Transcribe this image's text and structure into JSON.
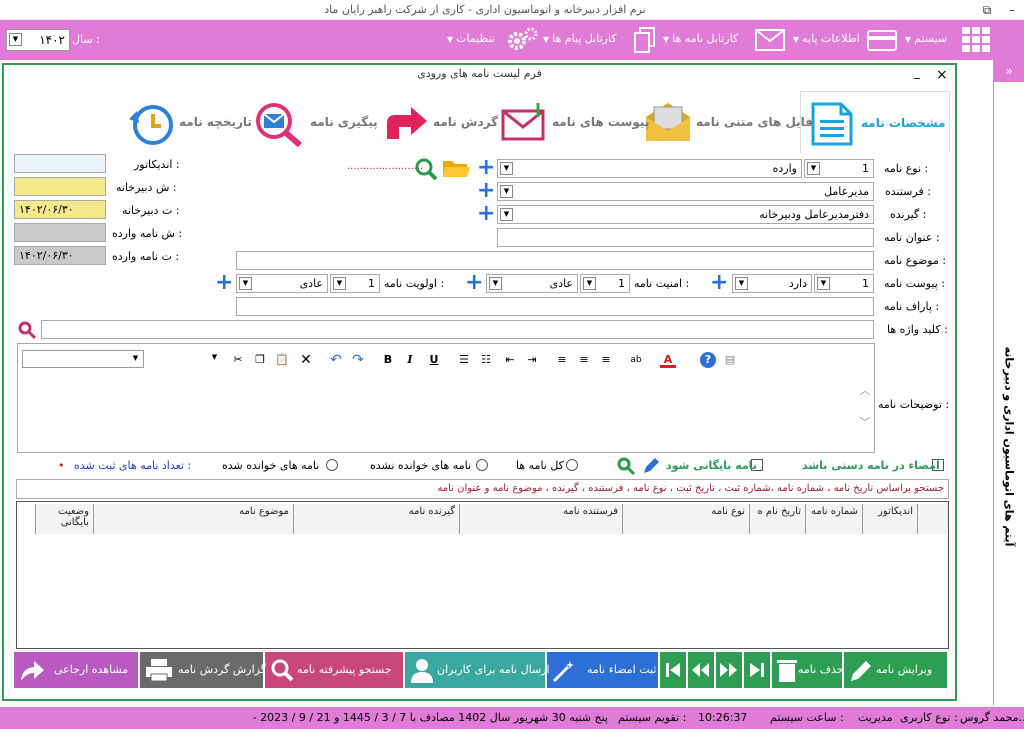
{
  "window": {
    "title": "نرم افزار دبیرخانه و اتوماسیون اداری - کاری از شرکت راهبر رایان ماد",
    "restore_icon": "⧉",
    "min_icon": "–"
  },
  "menubar": {
    "system": "سیستم",
    "base_info": "اطلاعات پایه",
    "letter_cardex": "کارتابل نامه ها",
    "message_cardex": "کارتابل پیام ها",
    "settings": "تنظیمات",
    "year_label": "سال :",
    "year_value": "۱۴۰۲"
  },
  "sidebar": {
    "toggle": "»",
    "title": "آیتم های اتوماسیون اداری و دبیرخانه"
  },
  "form": {
    "title": "فرم لیست نامه های ورودی",
    "close": "×",
    "min": "_",
    "tabs": {
      "specs": "مشخصات نامه",
      "text_files": "فایل های متنی نامه",
      "attachments": "پیوست های نامه",
      "circulation": "گردش نامه",
      "followup": "پیگیری نامه",
      "history": "تاریخچه نامه"
    },
    "fields": {
      "letter_type_label": "نوع نامه :",
      "letter_type_code": "1",
      "letter_type_value": "وارده",
      "sender_label": "فرستنده :",
      "sender_value": "مدیرعامل",
      "receiver_label": "گیرنده :",
      "receiver_value": "دفترمدیرعامل ودبیرخانه",
      "title_label": "عنوان نامه :",
      "subject_label": "موضوع نامه :",
      "attachment_label": "پیوست نامه :",
      "attachment_code": "1",
      "attachment_value": "دارد",
      "security_label": "امنیت نامه :",
      "security_code": "1",
      "security_value": "عادی",
      "priority_label": "اولویت نامه :",
      "priority_code": "1",
      "priority_value": "عادی",
      "paraf_label": "پاراف نامه :",
      "keywords_label": "کلید واژه ها :",
      "desc_label": "توضیحات نامه :",
      "indicator_label": "اندیکاتور :",
      "secretariat_no_label": "ش دبیرخانه :",
      "secretariat_date_label": "ت دبیرخانه :",
      "secretariat_date_value": "۱۴۰۲/۰۶/۳۰",
      "incoming_no_label": "ش نامه وارده :",
      "incoming_date_label": "ت نامه وارده :",
      "incoming_date_value": "۱۴۰۲/۰۶/۳۰",
      "dots": "........................"
    },
    "options": {
      "manual_sign": "امضاء در نامه دستی باشد",
      "archive": "نامه بایگانی شود",
      "all_letters": "کل نامه ها",
      "unread_letters": "نامه های خوانده نشده",
      "read_letters": "نامه های خوانده شده",
      "count_label": "تعداد نامه های ثبت شده :",
      "count_value": "•"
    },
    "search_hint": "جستجو براساس تاریخ نامه ، شماره نامه ،شماره ثبت ، تاریخ ثبت ، نوع نامه ، فرستنده ، گیرنده ، موضوع نامه و عنوان نامه",
    "grid_headers": [
      "اندیکاتور",
      "شماره نامه",
      "تاریخ نام ه",
      "نوع نامه",
      "فرستنده نامه",
      "گیرنده نامه",
      "موضوع نامه",
      "وضعیت بایگانی"
    ],
    "buttons": {
      "edit": "ویرایش نامه",
      "delete": "حذف نامه",
      "sign": "ثبت امضاء نامه",
      "send_users": "ارسال نامه برای کاربران",
      "adv_search": "جستجو پیشرفته نامه",
      "circulation_report": "گزارش گردش نامه",
      "view_referral": "مشاهده ارجاعی"
    }
  },
  "status": {
    "user": "محمد گروس...",
    "user_type_label": "نوع کاربری :",
    "user_type": "مدیریت",
    "time_label": "ساعت سیستم :",
    "time": "10:26:37",
    "calendar_label": "تقویم سیستم :",
    "calendar": "پنج شنبه   30   شهریور   سال   1402   مصادف با   7 / 3 / 1445   و   21 / 9 / 2023 -"
  },
  "colors": {
    "accent": "#e07bd8",
    "green": "#2f9a59",
    "blue": "#2c6fd6"
  }
}
